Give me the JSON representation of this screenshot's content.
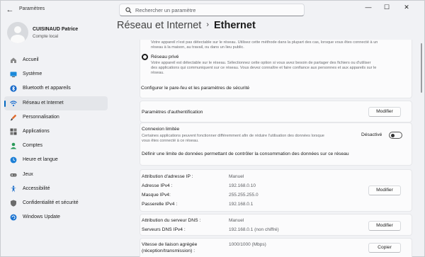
{
  "titlebar": {
    "app_title": "Paramètres",
    "search_placeholder": "Rechercher un paramètre"
  },
  "profile": {
    "name": "CUISINAUD Patrice",
    "account": "Compte local"
  },
  "sidebar": {
    "items": [
      {
        "label": "Accueil",
        "icon": "home-icon"
      },
      {
        "label": "Système",
        "icon": "monitor-icon"
      },
      {
        "label": "Bluetooth et appareils",
        "icon": "bluetooth-icon"
      },
      {
        "label": "Réseau et Internet",
        "icon": "wifi-icon",
        "active": true
      },
      {
        "label": "Personnalisation",
        "icon": "brush-icon"
      },
      {
        "label": "Applications",
        "icon": "apps-icon"
      },
      {
        "label": "Comptes",
        "icon": "account-icon"
      },
      {
        "label": "Heure et langue",
        "icon": "globe-clock-icon"
      },
      {
        "label": "Jeux",
        "icon": "gamepad-icon"
      },
      {
        "label": "Accessibilité",
        "icon": "accessibility-icon"
      },
      {
        "label": "Confidentialité et sécurité",
        "icon": "shield-icon"
      },
      {
        "label": "Windows Update",
        "icon": "update-icon"
      }
    ]
  },
  "breadcrumb": {
    "parent": "Réseau et Internet",
    "separator": "›",
    "current": "Ethernet"
  },
  "network_profile": {
    "public_desc_line1": "Votre appareil n'est pas détectable sur le réseau. Utilisez cette méthode dans la plupart des cas, lorsque vous êtes connecté à un",
    "public_desc_line2": "réseau à la maison, au travail, ou dans un lieu public.",
    "private_label": "Réseau privé",
    "private_desc_line1": "Votre appareil est détectable sur le réseau. Sélectionnez cette option si vous avez besoin de partager des fichiers ou d'utiliser",
    "private_desc_line2": "des applications qui communiquent sur ce réseau. Vous devez connaître et faire confiance aux personnes et aux appareils sur le",
    "private_desc_line3": "réseau.",
    "firewall_link": "Configurer le pare-feu et les paramètres de sécurité"
  },
  "auth": {
    "label": "Paramètres d'authentification",
    "button": "Modifier"
  },
  "metered": {
    "label": "Connexion limitée",
    "desc_line1": "Certaines applications peuvent fonctionner différemment afin de réduire l'utilisation des données lorsque",
    "desc_line2": "vous êtes connecté à ce réseau.",
    "state": "Désactivé",
    "toggle_on": false,
    "data_limit_link": "Définir une limite de données permettant de contrôler la consommation des données sur ce réseau"
  },
  "ip": {
    "rows": [
      {
        "label": "Attribution d'adresse IP :",
        "value": "Manuel"
      },
      {
        "label": "Adresse IPv4 :",
        "value": "192.168.0.10"
      },
      {
        "label": "Masque IPv4:",
        "value": "255.255.255.0"
      },
      {
        "label": "Passerelle IPv4 :",
        "value": "192.168.0.1"
      }
    ],
    "button": "Modifier"
  },
  "dns": {
    "rows": [
      {
        "label": "Attribution du serveur DNS :",
        "value": "Manuel"
      },
      {
        "label": "Serveurs DNS IPv4 :",
        "value": "192.168.0.1 (non chiffré)"
      }
    ],
    "button": "Modifier"
  },
  "link_speed": {
    "label_line1": "Vitesse de liaison agrégée",
    "label_line2": "(réception/transmission) :",
    "value": "1000/1000 (Mbps)",
    "button": "Copier"
  },
  "colors": {
    "accent": "#0067c0",
    "background": "#f1f2f5",
    "card": "#fbfbfc"
  }
}
